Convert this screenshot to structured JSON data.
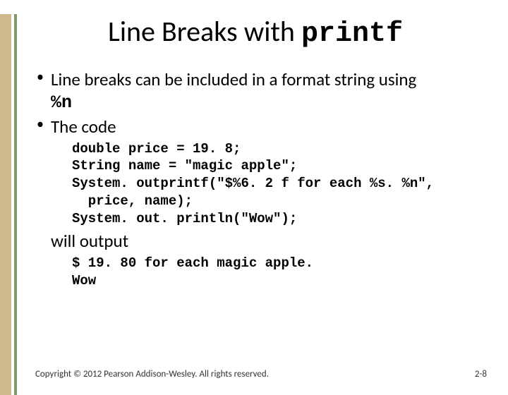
{
  "title": {
    "prefix": "Line Breaks with ",
    "mono": "printf"
  },
  "bullets": {
    "b1_prefix": "Line breaks can be included in a format string using ",
    "b1_code": "%n",
    "b2": "The code"
  },
  "code": {
    "line1": "double price = 19. 8;",
    "line2": "String name = \"magic apple\";",
    "line3": "System. outprintf(\"$%6. 2 f for each %s. %n\",",
    "line4": "  price, name);",
    "line5": "System. out. println(\"Wow\");"
  },
  "subLabel": "will output",
  "output": {
    "line1": "$ 19. 80 for each magic apple.",
    "line2": "Wow"
  },
  "footer": {
    "copyright": "Copyright © 2012 Pearson Addison-Wesley. All rights reserved.",
    "pageNum": "2-8"
  }
}
